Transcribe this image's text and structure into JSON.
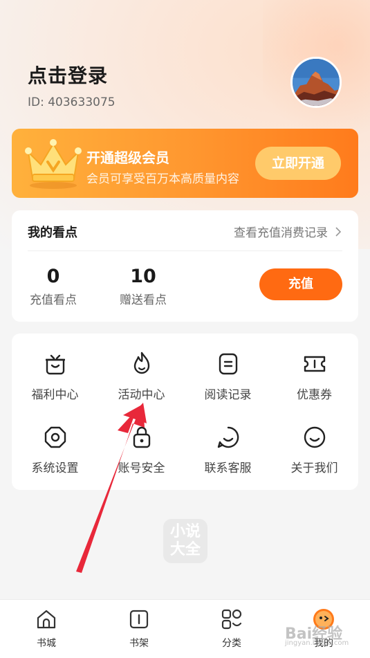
{
  "header": {
    "login_title": "点击登录",
    "user_id": "ID: 403633075"
  },
  "vip": {
    "title": "开通超级会员",
    "subtitle": "会员可享受百万本高质量内容",
    "button": "立即开通"
  },
  "points": {
    "title": "我的看点",
    "link": "查看充值消费记录",
    "recharge_value": "0",
    "recharge_label": "充值看点",
    "bonus_value": "10",
    "bonus_label": "赠送看点",
    "button": "充值"
  },
  "menu": [
    {
      "label": "福利中心",
      "icon": "gift-box-icon"
    },
    {
      "label": "活动中心",
      "icon": "flame-icon"
    },
    {
      "label": "阅读记录",
      "icon": "document-icon"
    },
    {
      "label": "优惠券",
      "icon": "coupon-icon"
    },
    {
      "label": "系统设置",
      "icon": "settings-icon"
    },
    {
      "label": "账号安全",
      "icon": "lock-icon"
    },
    {
      "label": "联系客服",
      "icon": "support-icon"
    },
    {
      "label": "关于我们",
      "icon": "smile-icon"
    }
  ],
  "watermark": {
    "line1": "小说",
    "line2": "大全"
  },
  "tabbar": [
    {
      "label": "书城",
      "icon": "home-icon"
    },
    {
      "label": "书架",
      "icon": "bookshelf-icon"
    },
    {
      "label": "分类",
      "icon": "category-icon"
    },
    {
      "label": "我的",
      "icon": "profile-icon"
    }
  ],
  "colors": {
    "accent": "#ff6a12",
    "vip_gradient_start": "#ffb13c",
    "vip_gradient_end": "#ff7b1c",
    "annotation_arrow": "#e8283a"
  },
  "overlay": {
    "baidu": "Bai经验",
    "baidu_sub": "jingyan.baidu.com"
  }
}
